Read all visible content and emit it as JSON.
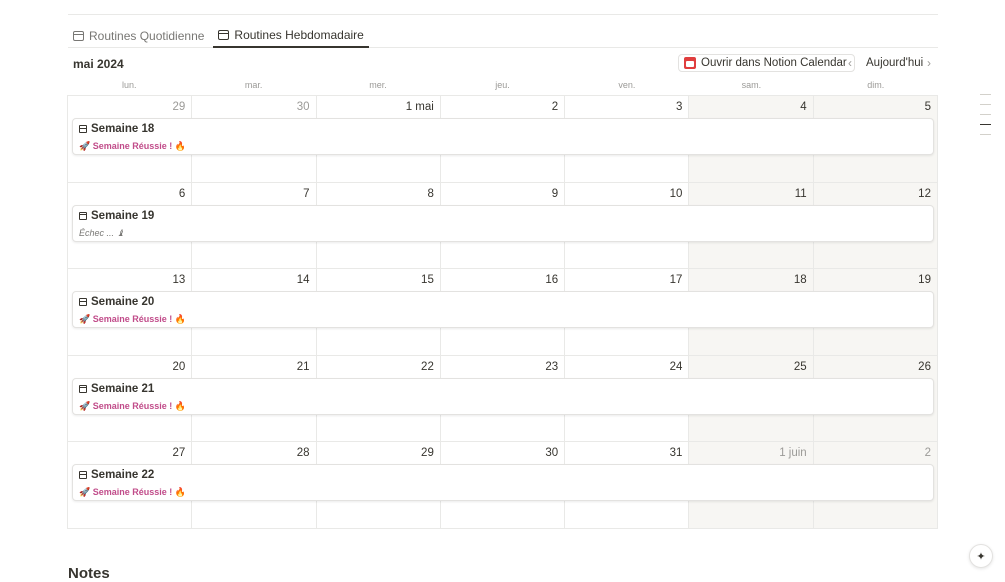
{
  "tabs": [
    {
      "label": "Routines Quotidienne",
      "active": false,
      "icon": "table-icon"
    },
    {
      "label": "Routines Hebdomadaire",
      "active": true,
      "icon": "calendar-icon"
    }
  ],
  "calendar": {
    "month_label": "mai 2024",
    "open_button_label": "Ouvrir dans Notion Calendar",
    "today_label": "Aujourd'hui",
    "prev_icon": "‹",
    "next_icon": "›",
    "weekdays": [
      "lun.",
      "mar.",
      "mer.",
      "jeu.",
      "ven.",
      "sam.",
      "dim."
    ],
    "weeks": [
      {
        "days": [
          {
            "n": "29",
            "o": true
          },
          {
            "n": "30",
            "o": true
          },
          {
            "n": "1 mai",
            "o": false
          },
          {
            "n": "2",
            "o": false
          },
          {
            "n": "3",
            "o": false
          },
          {
            "n": "4",
            "o": false
          },
          {
            "n": "5",
            "o": false
          }
        ],
        "card": {
          "title": "Semaine 18",
          "status": "🚀 Semaine Réussie ! 🔥",
          "success": true
        }
      },
      {
        "days": [
          {
            "n": "6",
            "o": false
          },
          {
            "n": "7",
            "o": false
          },
          {
            "n": "8",
            "o": false
          },
          {
            "n": "9",
            "o": false
          },
          {
            "n": "10",
            "o": false
          },
          {
            "n": "11",
            "o": false
          },
          {
            "n": "12",
            "o": false
          }
        ],
        "card": {
          "title": "Semaine 19",
          "status": "Échec ... ♝",
          "success": false
        }
      },
      {
        "days": [
          {
            "n": "13",
            "o": false
          },
          {
            "n": "14",
            "o": false
          },
          {
            "n": "15",
            "o": false
          },
          {
            "n": "16",
            "o": false
          },
          {
            "n": "17",
            "o": false
          },
          {
            "n": "18",
            "o": false
          },
          {
            "n": "19",
            "o": false
          }
        ],
        "card": {
          "title": "Semaine 20",
          "status": "🚀 Semaine Réussie ! 🔥",
          "success": true
        }
      },
      {
        "days": [
          {
            "n": "20",
            "o": false
          },
          {
            "n": "21",
            "o": false
          },
          {
            "n": "22",
            "o": false
          },
          {
            "n": "23",
            "o": false
          },
          {
            "n": "24",
            "o": false
          },
          {
            "n": "25",
            "o": false
          },
          {
            "n": "26",
            "o": false
          }
        ],
        "card": {
          "title": "Semaine 21",
          "status": "🚀 Semaine Réussie ! 🔥",
          "success": true
        }
      },
      {
        "days": [
          {
            "n": "27",
            "o": false
          },
          {
            "n": "28",
            "o": false
          },
          {
            "n": "29",
            "o": false
          },
          {
            "n": "30",
            "o": false
          },
          {
            "n": "31",
            "o": false
          },
          {
            "n": "1 juin",
            "o": true
          },
          {
            "n": "2",
            "o": true
          }
        ],
        "card": {
          "title": "Semaine 22",
          "status": "🚀 Semaine Réussie ! 🔥",
          "success": true
        }
      }
    ]
  },
  "notes_heading": "Notes",
  "colors": {
    "success_text": "#c14c8a",
    "weekend_bg": "#f7f6f3",
    "accent_red": "#e03e3e"
  },
  "ai_button_icon": "sparkle-icon"
}
